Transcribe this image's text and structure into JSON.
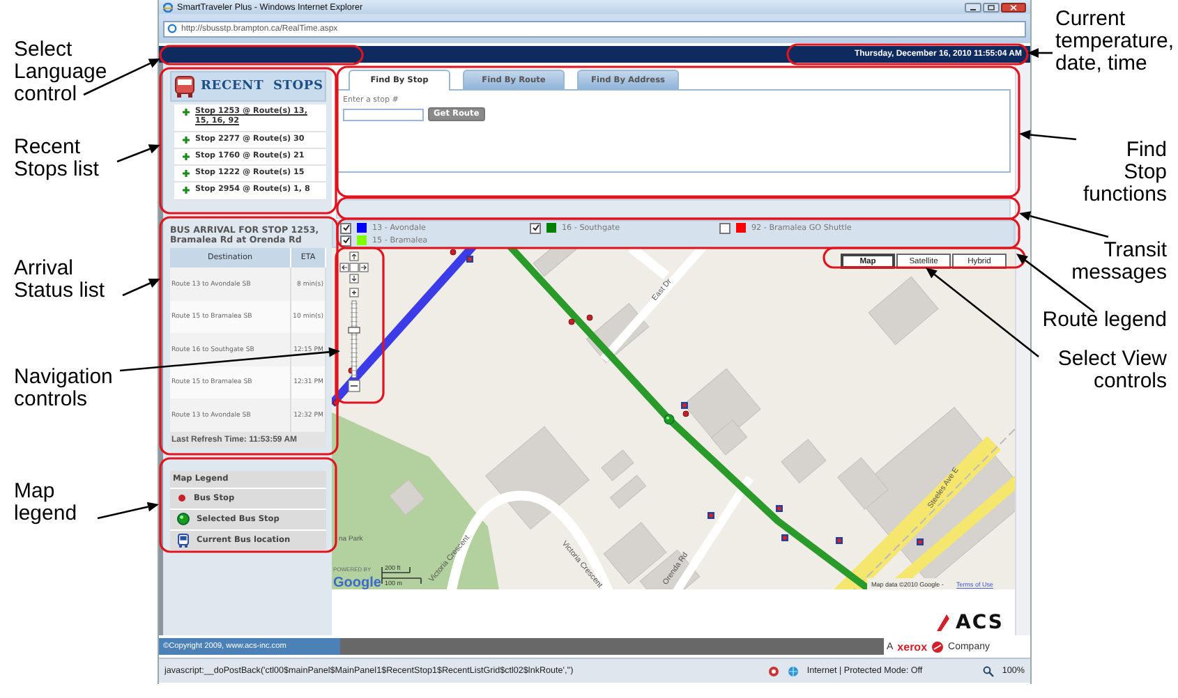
{
  "callouts_left": [
    {
      "text": "Select Language control"
    },
    {
      "text": "Recent Stops list"
    },
    {
      "text": "Arrival Status list"
    },
    {
      "text": "Navigation controls"
    },
    {
      "text": "Map legend"
    }
  ],
  "callouts_right": [
    {
      "text": "Current temperature, date, time"
    },
    {
      "text": "Find Stop functions"
    },
    {
      "text": "Transit messages"
    },
    {
      "text": "Route legend"
    },
    {
      "text": "Select View controls"
    }
  ],
  "browser": {
    "title": "SmartTraveler Plus - Windows Internet Explorer",
    "address": "http://sbusstp.brampton.ca/RealTime.aspx"
  },
  "header": {
    "datetime": "Thursday, December 16, 2010 11:55:04 AM"
  },
  "recent_stops": {
    "title": "RECENT  STOPS",
    "items": [
      {
        "label": "Stop 1253 @ Route(s) 13, 15, 16, 92",
        "selected": true
      },
      {
        "label": "Stop 2277 @ Route(s) 30",
        "selected": false
      },
      {
        "label": "Stop 1760 @ Route(s) 21",
        "selected": false
      },
      {
        "label": "Stop 1222 @ Route(s) 15",
        "selected": false
      },
      {
        "label": "Stop 2954 @ Route(s) 1, 8",
        "selected": false
      }
    ]
  },
  "arrival": {
    "title": "BUS ARRIVAL FOR STOP 1253, Bramalea Rd at Orenda Rd",
    "columns": [
      "Destination",
      "ETA"
    ],
    "rows": [
      [
        "Route 13 to Avondale SB",
        "8 min(s)"
      ],
      [
        "Route 15 to Bramalea SB",
        "10 min(s)"
      ],
      [
        "Route 16 to Southgate SB",
        "12:15 PM"
      ],
      [
        "Route 15 to Bramalea SB",
        "12:31 PM"
      ],
      [
        "Route 13 to Avondale SB",
        "12:32 PM"
      ]
    ],
    "refresh": "Last Refresh Time: 11:53:59 AM"
  },
  "map_legend": {
    "title": "Map Legend",
    "items": [
      {
        "kind": "stop",
        "label": "Bus Stop"
      },
      {
        "kind": "selected_stop",
        "label": "Selected Bus Stop"
      },
      {
        "kind": "bus",
        "label": "Current Bus location"
      }
    ]
  },
  "find_tabs": [
    {
      "label": "Find By Stop",
      "selected": true
    },
    {
      "label": "Find By Route",
      "selected": false
    },
    {
      "label": "Find By Address",
      "selected": false
    }
  ],
  "find_form": {
    "label": "Enter a stop #",
    "button": "Get Route"
  },
  "route_legend": [
    {
      "label": "13 - Avondale",
      "checked": true,
      "color": "#0000ff"
    },
    {
      "label": "16 - Southgate",
      "checked": true,
      "color": "#008000"
    },
    {
      "label": "92 - Bramalea GO Shuttle",
      "checked": false,
      "color": "#ff0000"
    },
    {
      "label": "15 - Bramalea",
      "checked": true,
      "color": "#80ff00"
    }
  ],
  "map": {
    "view_buttons": [
      {
        "label": "Map",
        "selected": true
      },
      {
        "label": "Satellite",
        "selected": false
      },
      {
        "label": "Hybrid",
        "selected": false
      }
    ],
    "zoom_slider": {
      "level": 0.62
    },
    "street_labels": [
      "East Dr",
      "Victoria Crescent",
      "Victoria Crescent",
      "Orenda Rd",
      "Steeles Ave E",
      "na Park"
    ],
    "powered_by": "POWERED BY",
    "google": "Google",
    "scale": [
      "200 ft",
      "100 m"
    ],
    "attribution": "Map data ©2010 Google -",
    "terms": "Terms of Use"
  },
  "logo": {
    "brand": "ACS",
    "prefix": "A",
    "partner": "xerox",
    "suffix": "Company"
  },
  "footer": {
    "copyright": "©Copyright 2009, www.acs-inc.com"
  },
  "status_bar": {
    "url": "javascript:__doPostBack('ctl00$mainPanel$MainPanel1$RecentStop1$RecentListGrid$ctl02$lnkRoute','')",
    "zone": "Internet | Protected Mode: Off",
    "zoom": "100%"
  }
}
